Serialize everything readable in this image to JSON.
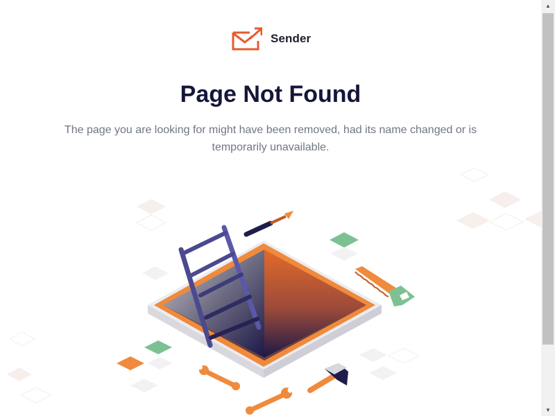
{
  "brand": {
    "name": "Sender",
    "logo_color": "#e85a2d"
  },
  "error": {
    "title": "Page Not Found",
    "message": "The page you are looking for might have been removed, had its name changed or is temporarily unavailable."
  },
  "illustration": {
    "description_icon": "hole-with-ladder-and-tools-illustration"
  },
  "colors": {
    "accent": "#f08a3c",
    "title": "#14163a",
    "text": "#707684",
    "green": "#7dc193"
  },
  "scrollbar": {
    "up_icon": "▲",
    "down_icon": "▼"
  }
}
